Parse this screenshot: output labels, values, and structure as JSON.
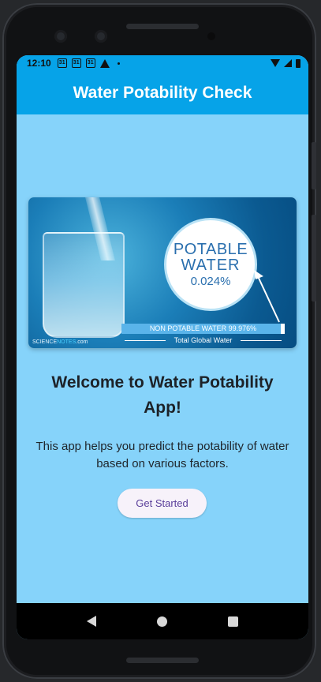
{
  "status_bar": {
    "time": "12:10",
    "calendar_icon_1": "31",
    "calendar_icon_2": "31",
    "calendar_icon_3": "31",
    "icons": [
      "calendar-icon",
      "calendar-icon",
      "calendar-icon",
      "warning-icon",
      "dot-icon",
      "wifi-icon",
      "signal-icon",
      "battery-icon"
    ]
  },
  "app_bar": {
    "title": "Water Potability Check",
    "color": "#06a3e8"
  },
  "banner": {
    "circle_line1": "POTABLE",
    "circle_line2": "WATER",
    "circle_percent": "0.024%",
    "non_potable": "NON POTABLE WATER 99.976%",
    "total": "Total Global Water",
    "logo_part1": "SCIENCE",
    "logo_part2": "NOTES",
    "logo_part3": ".com"
  },
  "main": {
    "welcome": "Welcome to Water Potability App!",
    "description": "This app helps you predict the potability of water based on various factors.",
    "button_label": "Get Started",
    "background_color": "#86d3fa"
  }
}
